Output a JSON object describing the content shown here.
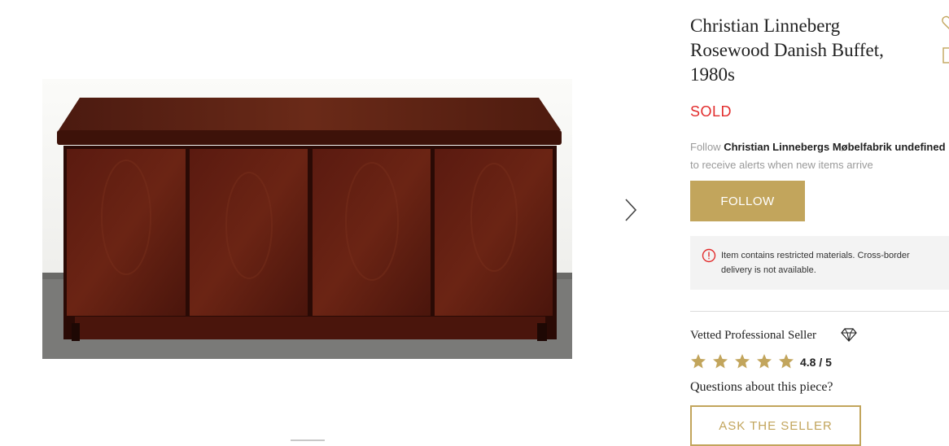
{
  "product": {
    "title": "Christian Linneberg Rosewood Danish Buffet, 1980s",
    "status": "SOLD"
  },
  "follow": {
    "prefix": "Follow",
    "maker": "Christian Linnebergs Møbelfabrik undefined",
    "subtext": "to receive alerts when new items arrive",
    "button_label": "FOLLOW"
  },
  "notice": {
    "icon": "alert-circle-icon",
    "text": "Item contains restricted materials. Cross-border delivery is not available."
  },
  "seller": {
    "badge_label": "Vetted Professional Seller",
    "badge_icon": "diamond-icon",
    "rating_value": 4.8,
    "rating_text": "4.8 / 5",
    "questions_label": "Questions about this piece?",
    "ask_button_label": "ASK THE SELLER"
  },
  "gallery": {
    "next_icon": "chevron-right-icon"
  },
  "colors": {
    "accent": "#c2a55c",
    "sold": "#e22c2c",
    "muted": "#9a9a9a",
    "notice_bg": "#f3f3f3"
  }
}
